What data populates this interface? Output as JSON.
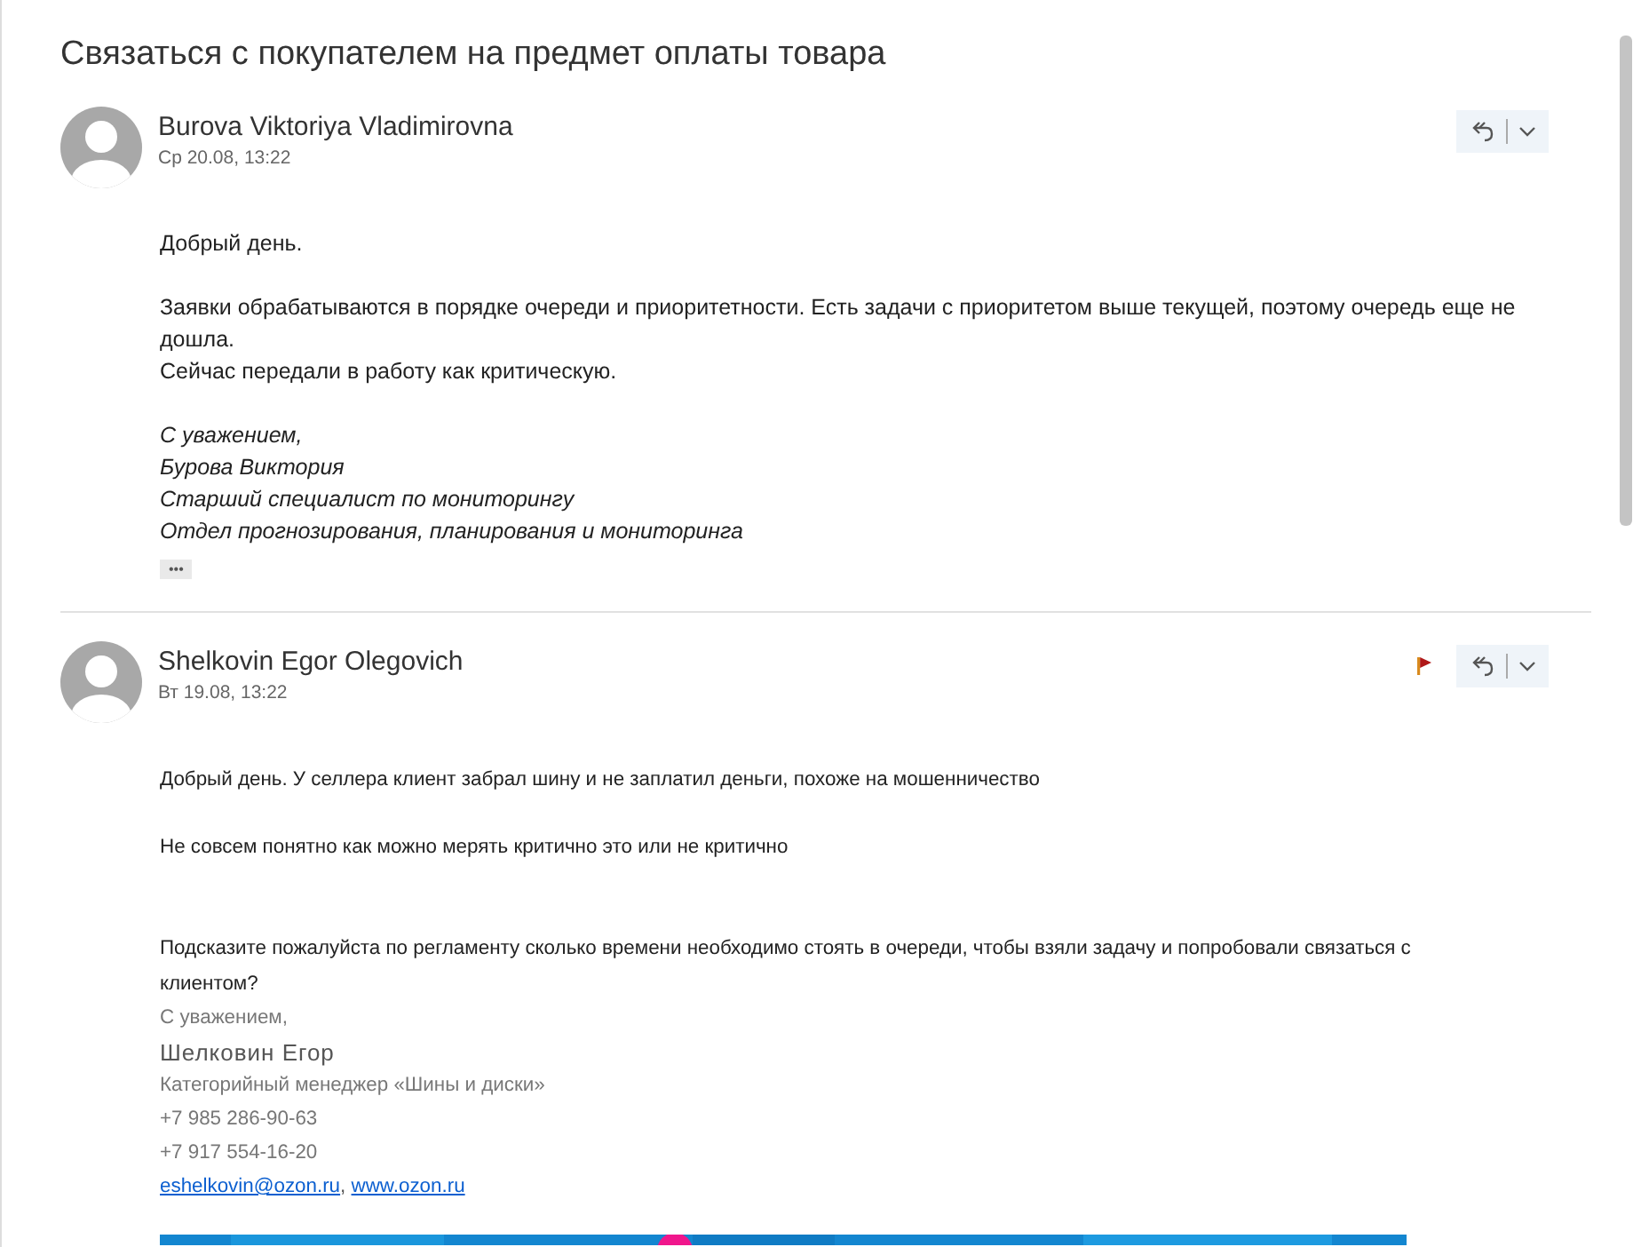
{
  "title": "Связаться с покупателем на предмет оплаты товара",
  "messages": [
    {
      "sender": "Burova Viktoriya Vladimirovna",
      "date": "Ср 20.08, 13:22",
      "flagged": false,
      "kind": "reply",
      "blocks": [
        {
          "kind": "text",
          "lines": [
            "Добрый день."
          ]
        },
        {
          "kind": "text",
          "lines": [
            "Заявки обрабатываются в порядке очереди и приоритетности. Есть задачи с приоритетом выше текущей, поэтому очередь еще не дошла.",
            "Сейчас передали в работу как критическую."
          ]
        },
        {
          "kind": "signature",
          "lines": [
            "С уважением,",
            "Бурова Виктория",
            "Старший специалист по мониторингу",
            "Отдел прогнозирования, планирования и мониторинга"
          ]
        }
      ],
      "more": "•••"
    },
    {
      "sender": "Shelkovin Egor Olegovich",
      "date": "Вт 19.08, 13:22",
      "flagged": true,
      "kind": "original",
      "blocks": [
        {
          "kind": "text",
          "lines": [
            "Добрый день. У селлера клиент забрал шину и не заплатил деньги, похоже на мошенничество"
          ]
        },
        {
          "kind": "text",
          "lines": [
            "Не совсем понятно как можно мерять критично это или не критично"
          ]
        },
        {
          "kind": "text",
          "lines": [
            "Подсказите пожалуйста по регламенту сколько времени необходимо стоять в очереди, чтобы взяли задачу и попробовали связаться с клиентом?"
          ]
        },
        {
          "kind": "contact",
          "lines": [
            "С уважением,"
          ]
        },
        {
          "kind": "contact-name",
          "lines": [
            "Шелковин Егор"
          ]
        },
        {
          "kind": "contact",
          "lines": [
            "Категорийный менеджер «Шины и диски»",
            "+7 985 286-90-63",
            "+7 917 554-16-20"
          ]
        },
        {
          "kind": "links",
          "links": [
            "eshelkovin@ozon.ru",
            "www.ozon.ru"
          ],
          "separator": ", "
        },
        {
          "kind": "picture"
        }
      ]
    }
  ]
}
